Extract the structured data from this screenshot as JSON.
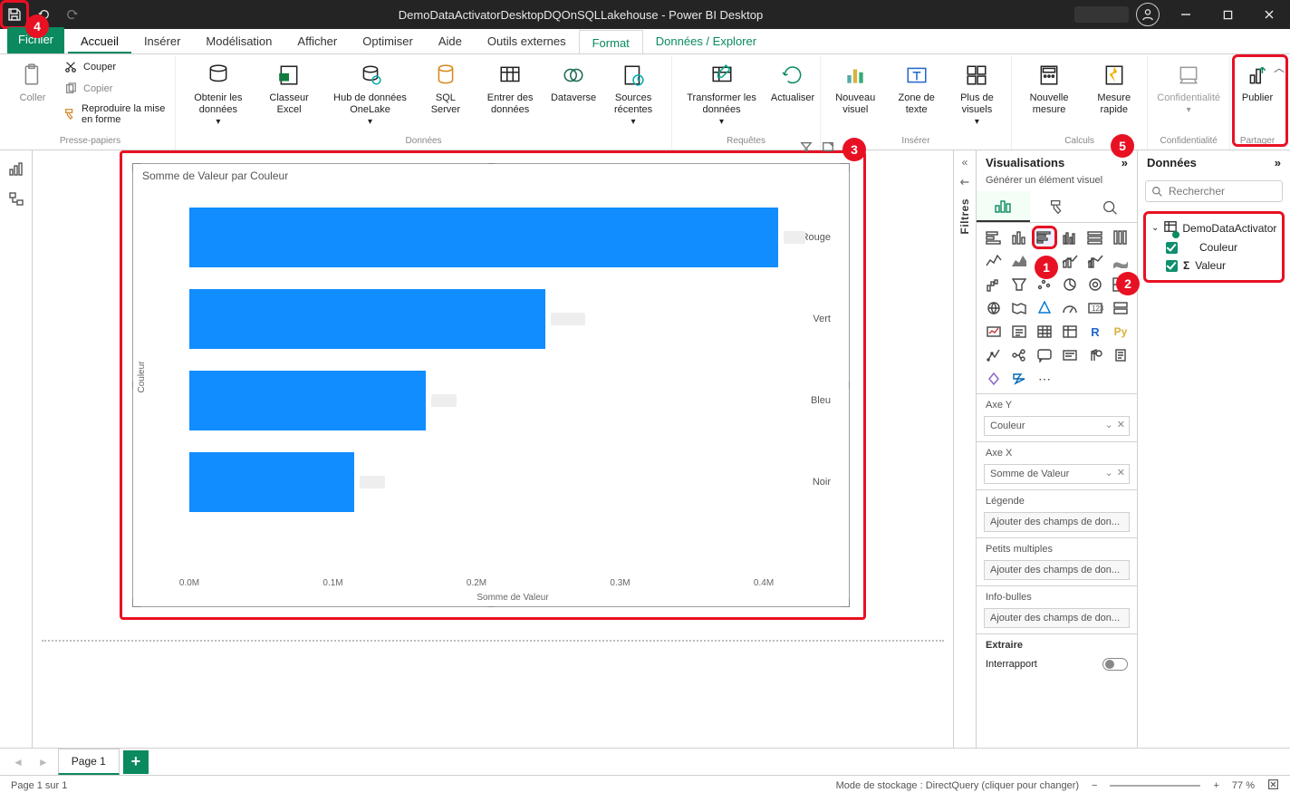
{
  "titlebar": {
    "title": "DemoDataActivatorDesktopDQOnSQLLakehouse - Power BI Desktop"
  },
  "menu": {
    "items": [
      "Fichier",
      "Accueil",
      "Insérer",
      "Modélisation",
      "Afficher",
      "Optimiser",
      "Aide",
      "Outils externes",
      "Format",
      "Données / Explorer"
    ],
    "activeIndex": 1,
    "greenIndices": [
      8,
      9
    ]
  },
  "ribbon": {
    "groups": {
      "clipboard": {
        "label": "Presse-papiers",
        "paste": "Coller",
        "cut": "Couper",
        "copy": "Copier",
        "format_painter": "Reproduire la mise en forme"
      },
      "data": {
        "label": "Données",
        "items": [
          "Obtenir les données",
          "Classeur Excel",
          "Hub de données OneLake",
          "SQL Server",
          "Entrer des données",
          "Dataverse",
          "Sources récentes"
        ]
      },
      "queries": {
        "label": "Requêtes",
        "transform": "Transformer les données",
        "refresh": "Actualiser"
      },
      "insert": {
        "label": "Insérer",
        "new_visual": "Nouveau visuel",
        "text_box": "Zone de texte",
        "more_visuals": "Plus de visuels"
      },
      "calc": {
        "label": "Calculs",
        "new_measure": "Nouvelle mesure",
        "quick_measure": "Mesure rapide"
      },
      "sensitivity": {
        "label": "Confidentialité",
        "btn": "Confidentialité"
      },
      "share": {
        "label": "Partager",
        "publish": "Publier"
      }
    }
  },
  "filters": {
    "label": "Filtres"
  },
  "viz_pane": {
    "title": "Visualisations",
    "subtitle": "Générer un élément visuel",
    "wells": {
      "axeY": {
        "label": "Axe Y",
        "value": "Couleur"
      },
      "axeX": {
        "label": "Axe X",
        "value": "Somme de Valeur"
      },
      "legend": {
        "label": "Légende",
        "placeholder": "Ajouter des champs de don..."
      },
      "small_mult": {
        "label": "Petits multiples",
        "placeholder": "Ajouter des champs de don..."
      },
      "tooltips": {
        "label": "Info-bulles",
        "placeholder": "Ajouter des champs de don..."
      },
      "drill": {
        "label": "Extraire",
        "cross": "Interrapport"
      }
    }
  },
  "data_pane": {
    "title": "Données",
    "search_placeholder": "Rechercher",
    "table": "DemoDataActivator",
    "fields": [
      {
        "name": "Couleur",
        "checked": true,
        "sigma": false
      },
      {
        "name": "Valeur",
        "checked": true,
        "sigma": true
      }
    ]
  },
  "chart": {
    "title": "Somme de Valeur par Couleur",
    "yaxis_title": "Couleur",
    "xaxis_title": "Somme de Valeur",
    "xticks": [
      "0.0M",
      "0.1M",
      "0.2M",
      "0.3M",
      "0.4M"
    ]
  },
  "chart_data": {
    "type": "bar",
    "orientation": "horizontal",
    "categories": [
      "Rouge",
      "Vert",
      "Bleu",
      "Noir"
    ],
    "values": [
      0.41,
      0.25,
      0.165,
      0.115
    ],
    "xlabel": "Somme de Valeur",
    "ylabel": "Couleur",
    "xlim": [
      0,
      0.45
    ],
    "unit": "M",
    "title": "Somme de Valeur par Couleur"
  },
  "pages": {
    "active": "Page 1"
  },
  "status": {
    "left": "Page 1 sur 1",
    "storage": "Mode de stockage : DirectQuery (cliquer pour changer)",
    "zoom": "77 %"
  },
  "callouts": {
    "1": "1",
    "2": "2",
    "3": "3",
    "4": "4",
    "5": "5"
  }
}
